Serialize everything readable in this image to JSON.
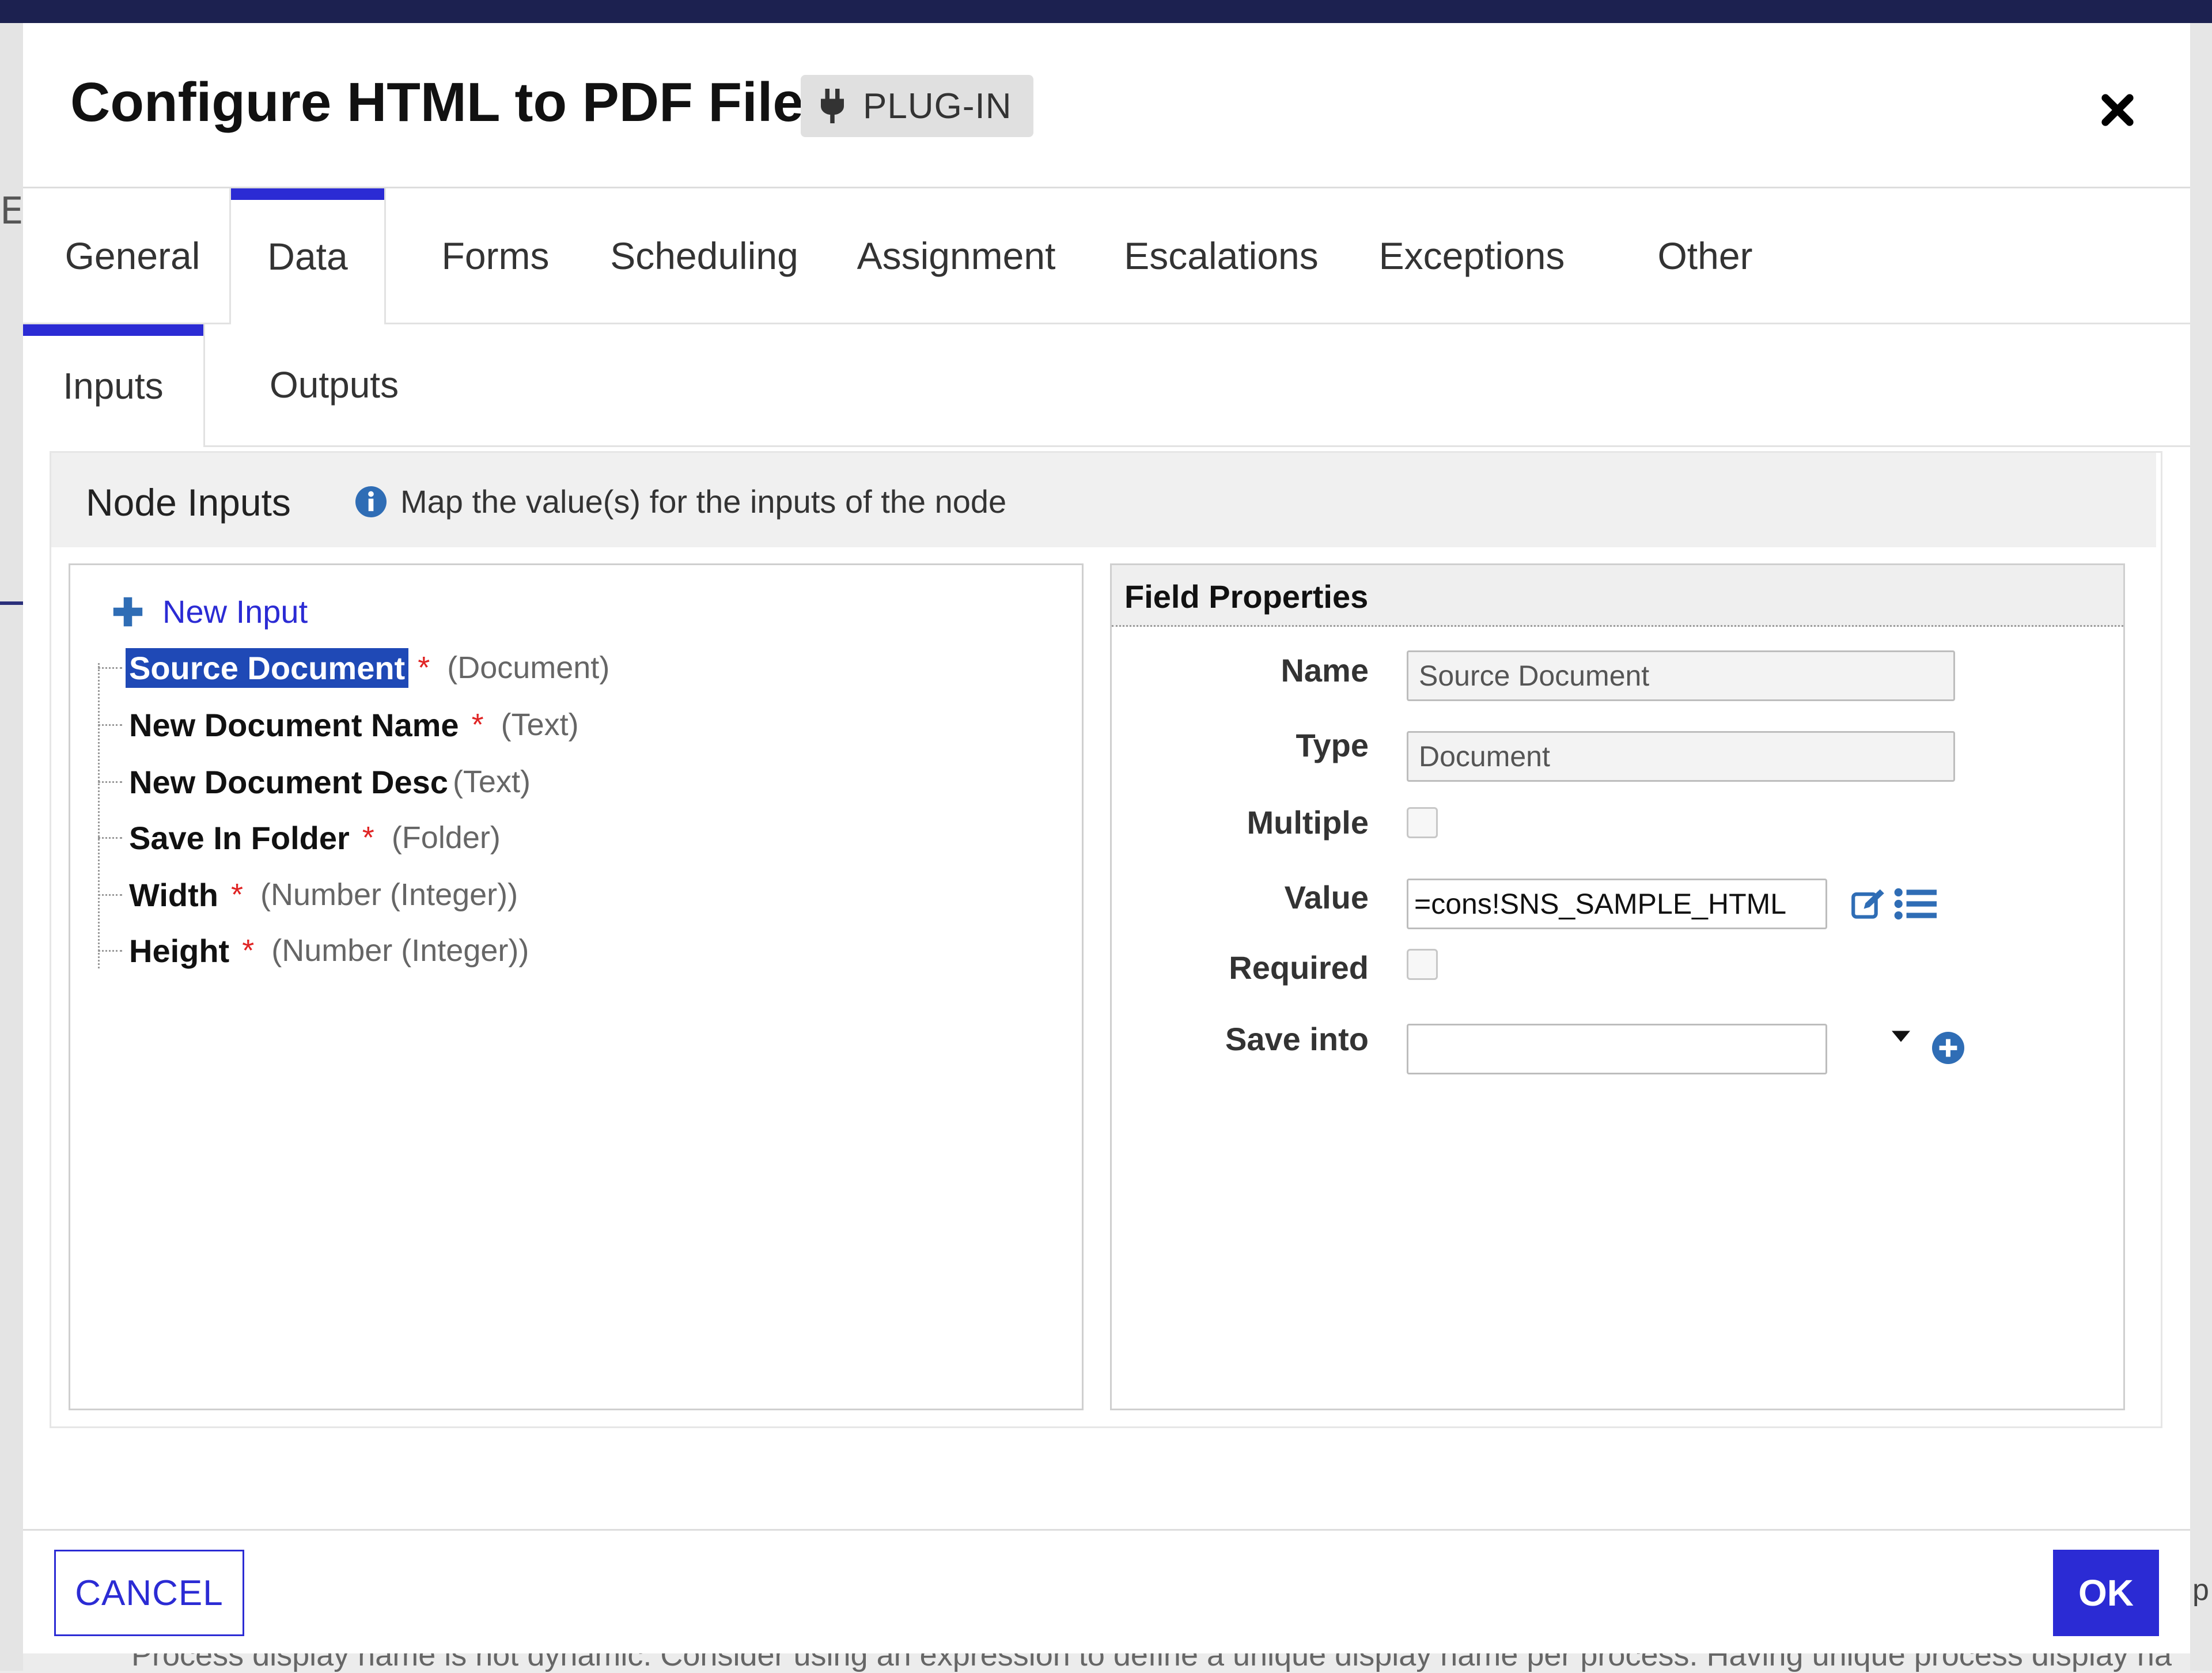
{
  "background": {
    "bottom_message": "Process display name is not dynamic. Consider using an expression to define a unique display name per process. Having unique process display na",
    "left_stub": "EE",
    "right_stub": "p"
  },
  "dialog": {
    "title": "Configure HTML to PDF File",
    "badge": {
      "icon": "plug-icon",
      "label": "PLUG-IN"
    },
    "close_icon": "close-icon"
  },
  "tabs": [
    {
      "label": "General"
    },
    {
      "label": "Data",
      "active": true
    },
    {
      "label": "Forms"
    },
    {
      "label": "Scheduling"
    },
    {
      "label": "Assignment"
    },
    {
      "label": "Escalations"
    },
    {
      "label": "Exceptions"
    },
    {
      "label": "Other"
    }
  ],
  "subtabs": [
    {
      "label": "Inputs",
      "active": true
    },
    {
      "label": "Outputs"
    }
  ],
  "node_inputs": {
    "title": "Node Inputs",
    "info_text": "Map the value(s) for the inputs of the node",
    "new_input_label": "New Input",
    "items": [
      {
        "name": "Source Document",
        "required": true,
        "type": "(Document)",
        "selected": true
      },
      {
        "name": "New Document Name",
        "required": true,
        "type": "(Text)"
      },
      {
        "name": "New Document Desc",
        "required": false,
        "type": "(Text)"
      },
      {
        "name": "Save In Folder",
        "required": true,
        "type": "(Folder)"
      },
      {
        "name": "Width",
        "required": true,
        "type": "(Number (Integer))"
      },
      {
        "name": "Height",
        "required": true,
        "type": "(Number (Integer))"
      }
    ],
    "required_marker": "*"
  },
  "field_properties": {
    "title": "Field Properties",
    "name_label": "Name",
    "name_value": "Source Document",
    "type_label": "Type",
    "type_value": "Document",
    "multiple_label": "Multiple",
    "multiple_checked": false,
    "value_label": "Value",
    "value_value": "=cons!SNS_SAMPLE_HTML",
    "required_label": "Required",
    "required_checked": false,
    "save_into_label": "Save into",
    "save_into_value": ""
  },
  "footer": {
    "cancel_label": "CANCEL",
    "ok_label": "OK"
  },
  "colors": {
    "accent": "#2b2bd4",
    "selection": "#1f49b6",
    "required": "#e02424",
    "info_icon": "#2f6db5"
  }
}
